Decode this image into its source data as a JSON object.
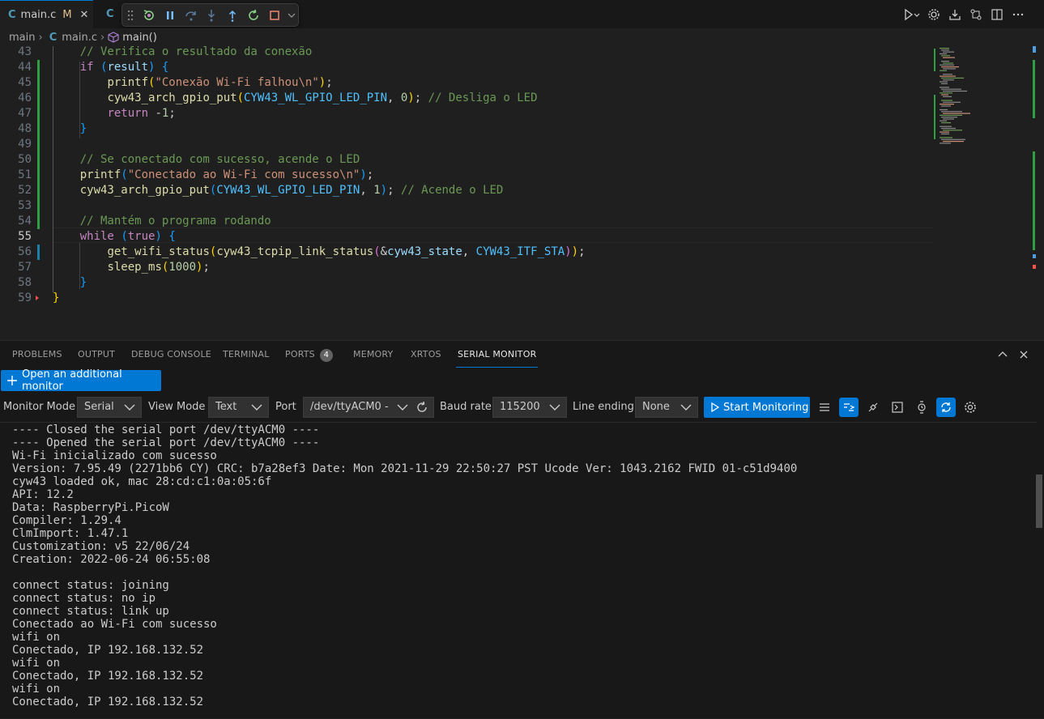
{
  "tabs": [
    {
      "icon": "c-file-icon",
      "icon_text": "C",
      "label": "main.c",
      "modified": "M",
      "active": true
    },
    {
      "icon": "c-file-icon",
      "icon_text": "C",
      "label": "",
      "active": false
    }
  ],
  "debug_toolbar": [
    "drag-handle-icon",
    "restart-icon",
    "pause-icon",
    "step-over-icon",
    "step-into-icon",
    "step-out-icon",
    "reload-icon",
    "stop-icon",
    "chevron-down-icon"
  ],
  "breadcrumb": {
    "folder": "main",
    "file_icon_text": "C",
    "file": "main.c",
    "symbol": "main()"
  },
  "editor": {
    "current_line": 55,
    "lines": [
      {
        "n": "43",
        "t": [
          [
            "    // Verifica o resultado da conexão",
            "cmt"
          ]
        ]
      },
      {
        "n": "44",
        "t": [
          [
            "    ",
            "pl"
          ],
          [
            "if",
            "kw"
          ],
          [
            " ",
            "pl"
          ],
          [
            "(",
            "b3"
          ],
          [
            "result",
            "var"
          ],
          [
            ")",
            "b3"
          ],
          [
            " ",
            "pl"
          ],
          [
            "{",
            "b3"
          ]
        ]
      },
      {
        "n": "45",
        "t": [
          [
            "        ",
            "pl"
          ],
          [
            "printf",
            "fn"
          ],
          [
            "(",
            "b1"
          ],
          [
            "\"Conexão Wi-Fi falhou\\n\"",
            "str"
          ],
          [
            ")",
            "b1"
          ],
          [
            ";",
            "pl"
          ]
        ]
      },
      {
        "n": "46",
        "t": [
          [
            "        ",
            "pl"
          ],
          [
            "cyw43_arch_gpio_put",
            "fn"
          ],
          [
            "(",
            "b1"
          ],
          [
            "CYW43_WL_GPIO_LED_PIN",
            "cst"
          ],
          [
            ", ",
            "pl"
          ],
          [
            "0",
            "num"
          ],
          [
            ")",
            "b1"
          ],
          [
            ";",
            "pl"
          ],
          [
            " // Desliga o LED",
            "cmt"
          ]
        ]
      },
      {
        "n": "47",
        "t": [
          [
            "        ",
            "pl"
          ],
          [
            "return",
            "kw"
          ],
          [
            " -",
            "pl"
          ],
          [
            "1",
            "num"
          ],
          [
            ";",
            "pl"
          ]
        ]
      },
      {
        "n": "48",
        "t": [
          [
            "    ",
            "pl"
          ],
          [
            "}",
            "b3"
          ]
        ]
      },
      {
        "n": "49",
        "t": []
      },
      {
        "n": "50",
        "t": [
          [
            "    // Se conectado com sucesso, acende o LED",
            "cmt"
          ]
        ]
      },
      {
        "n": "51",
        "t": [
          [
            "    ",
            "pl"
          ],
          [
            "printf",
            "fn"
          ],
          [
            "(",
            "b3"
          ],
          [
            "\"Conectado ao Wi-Fi com sucesso\\n\"",
            "str"
          ],
          [
            ")",
            "b3"
          ],
          [
            ";",
            "pl"
          ]
        ]
      },
      {
        "n": "52",
        "t": [
          [
            "    ",
            "pl"
          ],
          [
            "cyw43_arch_gpio_put",
            "fn"
          ],
          [
            "(",
            "b3"
          ],
          [
            "CYW43_WL_GPIO_LED_PIN",
            "cst"
          ],
          [
            ", ",
            "pl"
          ],
          [
            "1",
            "num"
          ],
          [
            ")",
            "b3"
          ],
          [
            ";",
            "pl"
          ],
          [
            " // Acende o LED",
            "cmt"
          ]
        ]
      },
      {
        "n": "53",
        "t": []
      },
      {
        "n": "54",
        "t": [
          [
            "    // Mantém o programa rodando",
            "cmt"
          ]
        ]
      },
      {
        "n": "55",
        "t": [
          [
            "    ",
            "pl"
          ],
          [
            "while",
            "kw"
          ],
          [
            " ",
            "pl"
          ],
          [
            "(",
            "b3"
          ],
          [
            "true",
            "kw"
          ],
          [
            ")",
            "b3"
          ],
          [
            " ",
            "pl"
          ],
          [
            "{",
            "b3"
          ]
        ]
      },
      {
        "n": "56",
        "t": [
          [
            "        ",
            "pl"
          ],
          [
            "get_wifi_status",
            "fn"
          ],
          [
            "(",
            "b1"
          ],
          [
            "cyw43_tcpip_link_status",
            "fn"
          ],
          [
            "(",
            "b2"
          ],
          [
            "&",
            "pl"
          ],
          [
            "cyw43_state",
            "var"
          ],
          [
            ", ",
            "pl"
          ],
          [
            "CYW43_ITF_STA",
            "cst"
          ],
          [
            ")",
            "b2"
          ],
          [
            ")",
            "b1"
          ],
          [
            ";",
            "pl"
          ]
        ]
      },
      {
        "n": "57",
        "t": [
          [
            "        ",
            "pl"
          ],
          [
            "sleep_ms",
            "fn"
          ],
          [
            "(",
            "b1"
          ],
          [
            "1000",
            "num"
          ],
          [
            ")",
            "b1"
          ],
          [
            ";",
            "pl"
          ]
        ]
      },
      {
        "n": "58",
        "t": [
          [
            "    ",
            "pl"
          ],
          [
            "}",
            "b3"
          ]
        ]
      },
      {
        "n": "59",
        "t": [
          [
            "}",
            "b1"
          ]
        ]
      }
    ]
  },
  "panel": {
    "tabs": [
      {
        "label": "PROBLEMS"
      },
      {
        "label": "OUTPUT"
      },
      {
        "label": "DEBUG CONSOLE"
      },
      {
        "label": "TERMINAL"
      },
      {
        "label": "PORTS",
        "badge": "4"
      },
      {
        "label": "MEMORY"
      },
      {
        "label": "XRTOS"
      },
      {
        "label": "SERIAL MONITOR",
        "active": true
      }
    ],
    "open_monitor_label": "Open an additional monitor",
    "monitor_mode_label": "Monitor Mode",
    "monitor_mode_value": "Serial",
    "view_mode_label": "View Mode",
    "view_mode_value": "Text",
    "port_label": "Port",
    "port_value": "/dev/ttyACM0 -",
    "baud_label": "Baud rate",
    "baud_value": "115200",
    "line_ending_label": "Line ending",
    "line_ending_value": "None",
    "start_label": "Start Monitoring",
    "output": [
      "---- Closed the serial port /dev/ttyACM0 ----",
      "---- Opened the serial port /dev/ttyACM0 ----",
      "Wi-Fi inicializado com sucesso",
      "Version: 7.95.49 (2271bb6 CY) CRC: b7a28ef3 Date: Mon 2021-11-29 22:50:27 PST Ucode Ver: 1043.2162 FWID 01-c51d9400",
      "cyw43 loaded ok, mac 28:cd:c1:0a:05:6f",
      "API: 12.2",
      "Data: RaspberryPi.PicoW",
      "Compiler: 1.29.4",
      "ClmImport: 1.47.1",
      "Customization: v5 22/06/24",
      "Creation: 2022-06-24 06:55:08",
      "",
      "connect status: joining",
      "connect status: no ip",
      "connect status: link up",
      "Conectado ao Wi-Fi com sucesso",
      "wifi on",
      "Conectado, IP 192.168.132.52",
      "wifi on",
      "Conectado, IP 192.168.132.52",
      "wifi on",
      "Conectado, IP 192.168.132.52"
    ]
  },
  "colors": {
    "accent": "#0078d4",
    "comment": "#6a9955",
    "keyword": "#c586c0",
    "function": "#dcdcaa",
    "string": "#ce9178",
    "number": "#b5cea8",
    "constant": "#4fc1ff",
    "modified": "#e2c08d"
  }
}
